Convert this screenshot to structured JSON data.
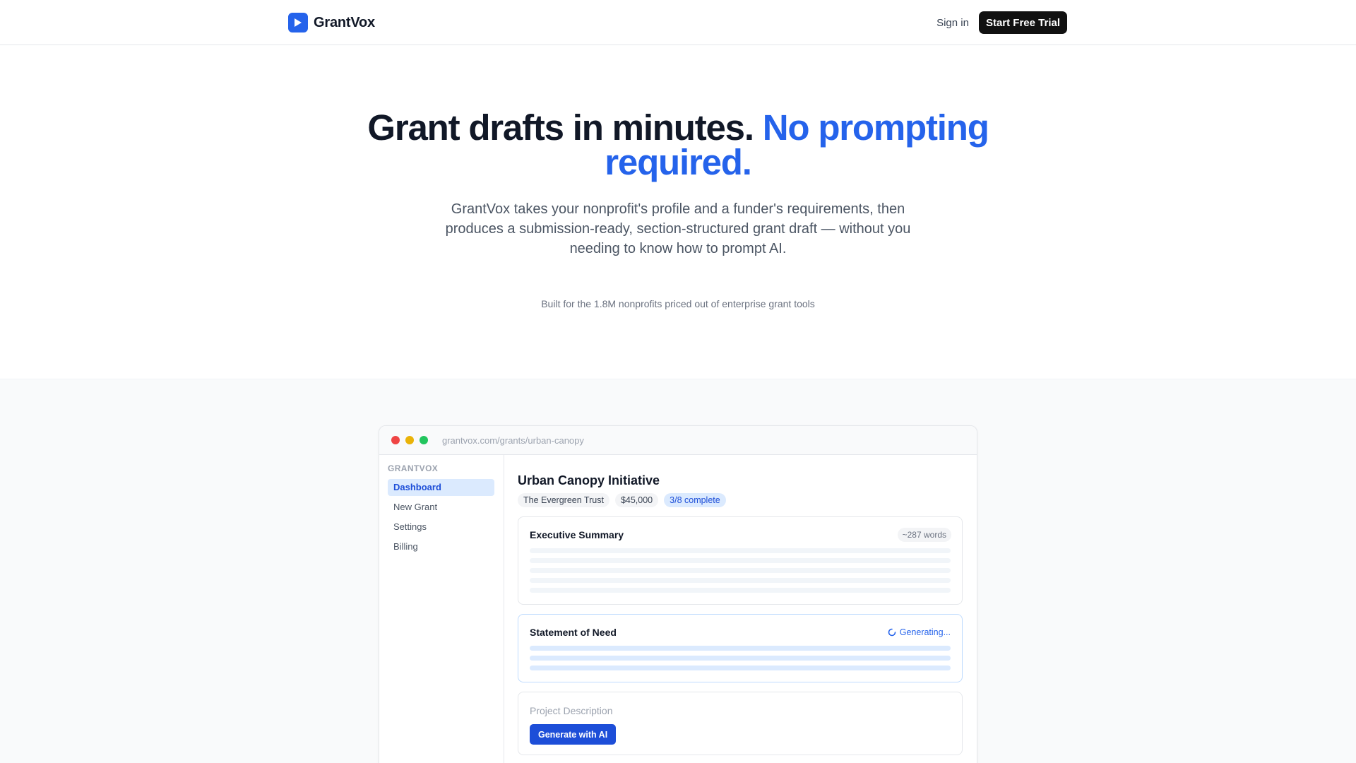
{
  "header": {
    "brand": "GrantVox",
    "sign_in": "Sign in",
    "cta": "Start Free Trial"
  },
  "hero": {
    "headline_main": "Grant drafts in minutes.",
    "headline_accent": "No prompting required.",
    "subtitle": "GrantVox takes your nonprofit's profile and a funder's requirements, then produces a submission-ready, section-structured grant draft — without you needing to know how to prompt AI.",
    "note": "Built for the 1.8M nonprofits priced out of enterprise grant tools"
  },
  "preview": {
    "url": "grantvox.com/grants/urban-canopy",
    "sidebar": {
      "brand": "GRANTVOX",
      "items": [
        {
          "label": "Dashboard",
          "active": true
        },
        {
          "label": "New Grant",
          "active": false
        },
        {
          "label": "Settings",
          "active": false
        },
        {
          "label": "Billing",
          "active": false
        }
      ]
    },
    "project": {
      "title": "Urban Canopy Initiative",
      "funder": "The Evergreen Trust",
      "amount": "$45,000",
      "progress": "3/8 complete"
    },
    "sections": [
      {
        "title": "Executive Summary",
        "status": "~287 words"
      },
      {
        "title": "Statement of Need",
        "status": "Generating..."
      },
      {
        "title": "Project Description",
        "action": "Generate with AI"
      }
    ]
  },
  "colors": {
    "accent": "#2563eb",
    "dark": "#111111",
    "traffic_red": "#ef4444",
    "traffic_yellow": "#eab308",
    "traffic_green": "#22c55e"
  }
}
